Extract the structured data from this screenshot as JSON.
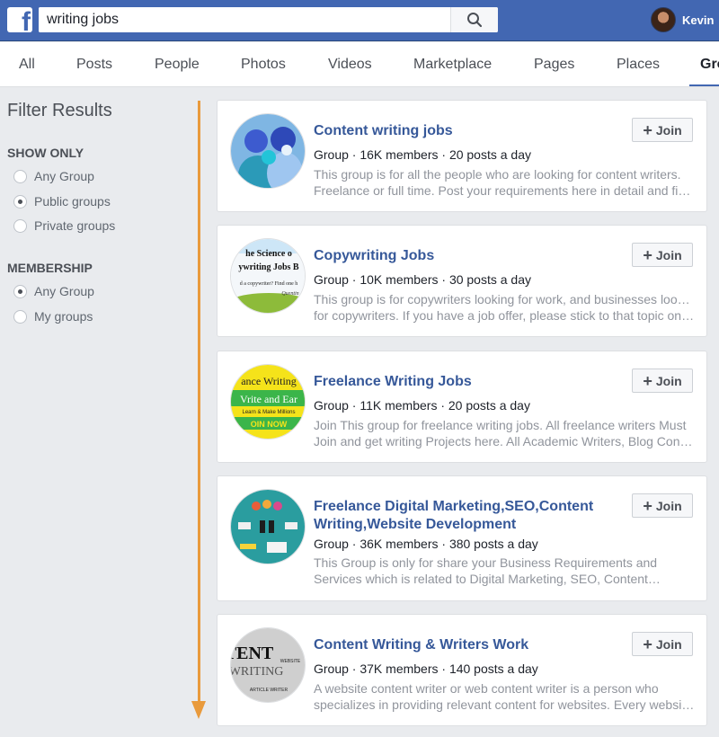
{
  "header": {
    "logo": "f",
    "search_value": "writing jobs",
    "search_icon": "search-icon",
    "user_name": "Kevin"
  },
  "tabs": [
    {
      "label": "All"
    },
    {
      "label": "Posts"
    },
    {
      "label": "People"
    },
    {
      "label": "Photos"
    },
    {
      "label": "Videos"
    },
    {
      "label": "Marketplace"
    },
    {
      "label": "Pages"
    },
    {
      "label": "Places"
    },
    {
      "label": "Groups",
      "active": true
    }
  ],
  "sidebar": {
    "title": "Filter Results",
    "show_only": {
      "title": "SHOW ONLY",
      "options": [
        {
          "label": "Any Group",
          "checked": false
        },
        {
          "label": "Public groups",
          "checked": true
        },
        {
          "label": "Private groups",
          "checked": false
        }
      ]
    },
    "membership": {
      "title": "MEMBERSHIP",
      "options": [
        {
          "label": "Any Group",
          "checked": true
        },
        {
          "label": "My groups",
          "checked": false
        }
      ]
    }
  },
  "join_label": "Join",
  "results": [
    {
      "title": "Content writing jobs",
      "meta": "Group · 16K members · 20 posts a day",
      "desc1": "This group is for all the people who are looking for content writers.",
      "desc2": "Freelance or full time. Post your requirements here in detail and find…"
    },
    {
      "title": "Copywriting Jobs",
      "meta": "Group · 10K members · 30 posts a day",
      "desc1": "This group is for copywriters looking for work, and businesses looking",
      "desc2": "for copywriters. If you have a job offer, please stick to that topic onl…",
      "image_text": [
        "he Science o",
        "ywriting Jobs B",
        "d a copywriter? Find one h",
        "Quentin"
      ]
    },
    {
      "title": "Freelance Writing Jobs",
      "meta": "Group · 11K members · 20 posts a day",
      "desc1": "Join This group for freelance writing jobs. All freelance writers Must",
      "desc2": "Join and get writing Projects here. All Academic Writers, Blog Conte…",
      "image_text": [
        "ance Writing",
        "Vrite and Ear",
        "Learn & Make Millions",
        "OIN NOW"
      ]
    },
    {
      "title": "Freelance Digital Marketing,SEO,Content Writing,Website Development",
      "meta": "Group · 36K members · 380 posts a day",
      "desc1": "This Group is only for share your Business Requirements and",
      "desc2": "Services which is related to Digital Marketing, SEO, Content…"
    },
    {
      "title": "Content Writing & Writers Work",
      "meta": "Group · 37K members · 140 posts a day",
      "desc1": "A website content writer or web content writer is a person who",
      "desc2": "specializes in providing relevant content for websites. Every website…",
      "image_text": [
        "TENT",
        "WRITING",
        "WEBSITE",
        "ARTICLE WRITER"
      ]
    }
  ]
}
